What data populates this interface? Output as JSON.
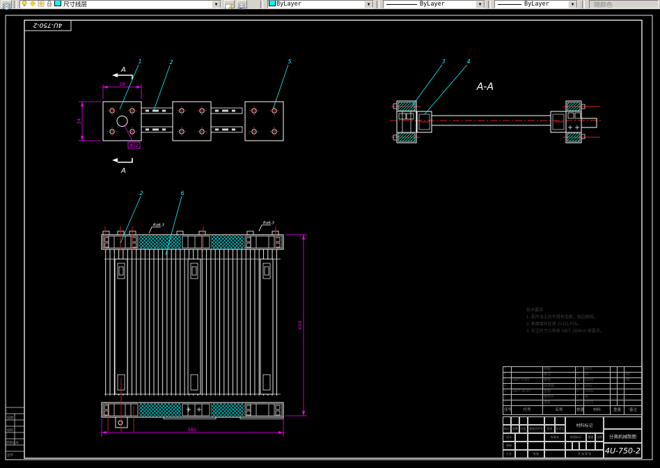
{
  "toolbar": {
    "layer_combo": {
      "value": "尺寸线层"
    },
    "color_combo": {
      "value": "ByLayer"
    },
    "linetype_combo": {
      "value": "ByLayer"
    },
    "lineweight_combo": {
      "value": "ByLayer"
    },
    "plotstyle_combo": {
      "value": "随颜色"
    },
    "colors": {
      "layer_swatch": "#00ffff",
      "color_swatch": "#00ffff"
    }
  },
  "sheet": {
    "corner_number": "4U-750-2",
    "margin_labels": [
      "描图",
      "描校",
      "底图总号",
      "签字"
    ]
  },
  "views": {
    "top_view": {
      "balloon_1": "1",
      "balloon_2": "2",
      "balloon_5": "5",
      "section_mark_top": "A",
      "section_mark_bottom": "A",
      "dim_width": "28",
      "dim_height": "24",
      "hole_label": "Φ12"
    },
    "section_view": {
      "title": "A-A",
      "balloon_3": "3",
      "balloon_4": "4"
    },
    "front_view": {
      "balloon_2": "2",
      "balloon_6": "6",
      "dim_width": "585",
      "dim_height": "650",
      "roughness_1": "Ra6.3",
      "roughness_2": "Ra6.3"
    }
  },
  "notes": {
    "title": "技术要求",
    "line1": "1. 零件加工后不得有毛刺，锐边倒钝。",
    "line2": "2. 表面镀锌处理 Zn.D2-F05。",
    "line3": "3. 未注尺寸公差按 GB/T 1804-m 级要求。"
  },
  "bom": {
    "headers": {
      "seq": "序号",
      "code": "代号",
      "name": "名称",
      "qty": "数量",
      "material": "材料",
      "weight": "重量",
      "remark": "备注"
    },
    "rows": [
      {
        "seq": "7",
        "code": "",
        "name": "挡圈",
        "qty": "1",
        "material": "40Cr",
        "remark": ""
      },
      {
        "seq": "6",
        "code": "",
        "name": "螺母",
        "qty": "8",
        "material": "45",
        "remark": "M8"
      },
      {
        "seq": "5",
        "code": "GB/T 5783",
        "name": "螺栓",
        "qty": "24",
        "material": "Q235",
        "remark": "M6"
      },
      {
        "seq": "4",
        "code": "",
        "name": "连接轴",
        "qty": "4",
        "material": "40Cr",
        "remark": ""
      },
      {
        "seq": "3",
        "code": "GB/T 93-87",
        "name": "垫圈",
        "qty": "8",
        "material": "65Mn",
        "remark": ""
      },
      {
        "seq": "2",
        "code": "",
        "name": "散热片",
        "qty": "2",
        "material": "铝",
        "remark": ""
      },
      {
        "seq": "1",
        "code": "",
        "name": "端板",
        "qty": "4",
        "material": "Q235",
        "remark": ""
      }
    ]
  },
  "titleblock": {
    "material_mark": "材料标记",
    "company": "分离机械制图",
    "drawing_number": "4U-750-2",
    "rev_labels": [
      "标记",
      "处数",
      "分区",
      "更改文件号",
      "签名",
      "年月日"
    ],
    "design": "设计",
    "check": "审核",
    "process": "工艺",
    "standard": "标准化",
    "approve": "批准",
    "stage_label": "阶段标记",
    "weight_label": "重量",
    "scale_label": "比例",
    "sheet_info": "共 张 第 张"
  }
}
